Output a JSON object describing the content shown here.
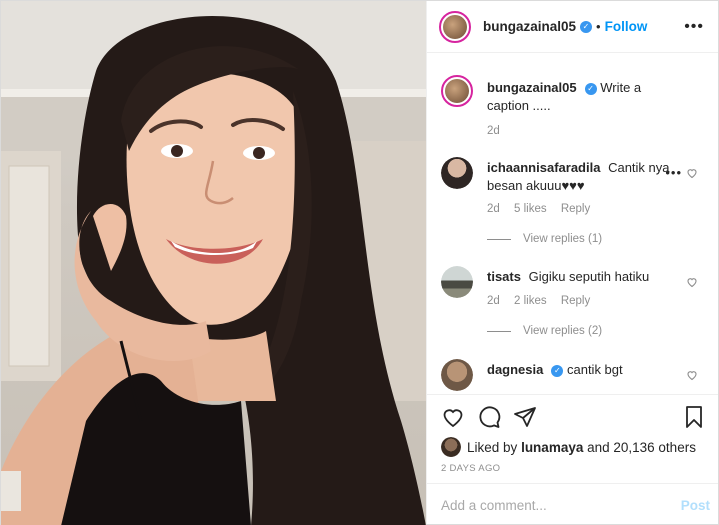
{
  "header": {
    "username": "bungazainal05",
    "separator": "•",
    "follow_label": "Follow",
    "more_label": "•••"
  },
  "caption": {
    "username": "bungazainal05",
    "text": "Write a caption .....",
    "age": "2d"
  },
  "comments": [
    {
      "username": "ichaannisafaradila",
      "text": "Cantik nya besan akuuu♥♥♥",
      "age": "2d",
      "likes": "5 likes",
      "reply_label": "Reply",
      "view_replies": "View replies (1)"
    },
    {
      "username": "tisats",
      "text": "Gigiku seputih hatiku",
      "age": "2d",
      "likes": "2 likes",
      "reply_label": "Reply",
      "view_replies": "View replies (2)"
    },
    {
      "username": "dagnesia",
      "text": "cantik bgt"
    }
  ],
  "comment_more": "•••",
  "likes": {
    "prefix": "Liked by",
    "user": "lunamaya",
    "suffix": "and 20,136 others"
  },
  "timestamp": "2 DAYS AGO",
  "add_comment": {
    "placeholder": "Add a comment...",
    "post_label": "Post"
  },
  "colors": {
    "accent": "#0095f6",
    "verified": "#3897f0",
    "muted": "#8e8e8e"
  }
}
